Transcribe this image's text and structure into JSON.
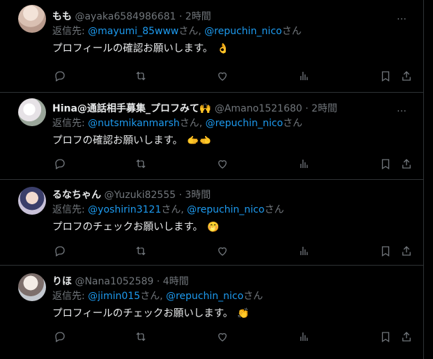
{
  "colors": {
    "background": "#000000",
    "text": "#e7e9ea",
    "muted": "#71767b",
    "link": "#1d9bf0",
    "divider": "#2f3336"
  },
  "reply_prefix": "返信先: ",
  "san": "さん",
  "comma": ", ",
  "dot": " · ",
  "more_icon": "…",
  "tweets": [
    {
      "name": "もも",
      "handle": "@ayaka6584986681",
      "time": "2時間",
      "mention1": "@mayumi_85www",
      "mention2": "@repuchin_nico",
      "text": "プロフィールの確認お願いします。",
      "emoji": "👌"
    },
    {
      "name": "Hina@通話相手募集_プロフみて🙌",
      "handle": "@Amano1521680",
      "time": "2時間",
      "mention1": "@nutsmikanmarsh",
      "mention2": "@repuchin_nico",
      "text": "プロフの確認お願いします。",
      "emoji": "🫱🫲"
    },
    {
      "name": "るなちゃん",
      "handle": "@Yuzuki82555",
      "time": "3時間",
      "mention1": "@yoshirin3121",
      "mention2": "@repuchin_nico",
      "text": "プロフのチェックお願いします。",
      "emoji": "🤭"
    },
    {
      "name": "りほ",
      "handle": "@Nana1052589",
      "time": "4時間",
      "mention1": "@jimin015",
      "mention2": "@repuchin_nico",
      "text": "プロフィールのチェックお願いします。",
      "emoji": "👏"
    }
  ]
}
